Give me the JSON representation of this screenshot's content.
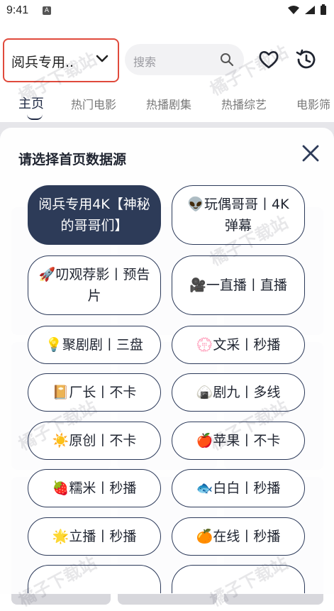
{
  "status_bar": {
    "time": "9:41",
    "notif": "A"
  },
  "header": {
    "source_label": "阅兵专用..",
    "search_placeholder": "搜索"
  },
  "tabs": [
    {
      "label": "主页"
    },
    {
      "label": "热门电影"
    },
    {
      "label": "热播剧集"
    },
    {
      "label": "热播综艺"
    },
    {
      "label": "电影筛"
    }
  ],
  "sheet": {
    "title": "请选择首页数据源",
    "options": [
      {
        "label": "阅兵专用4K【神秘的哥哥们】",
        "selected": true
      },
      {
        "label": "👽玩偶哥哥丨4K弹幕",
        "selected": false
      },
      {
        "label": "🚀叨观荐影丨预告片",
        "selected": false
      },
      {
        "label": "🎥一直播丨直播",
        "selected": false
      },
      {
        "label": "💡聚剧剧丨三盘",
        "selected": false
      },
      {
        "label": "💮文采丨秒播",
        "selected": false
      },
      {
        "label": "📔厂长丨不卡",
        "selected": false
      },
      {
        "label": "🍙剧九丨多线",
        "selected": false
      },
      {
        "label": "☀️原创丨不卡",
        "selected": false
      },
      {
        "label": "🍎苹果丨不卡",
        "selected": false
      },
      {
        "label": "🍓糯米丨秒播",
        "selected": false
      },
      {
        "label": "🐟白白丨秒播",
        "selected": false
      },
      {
        "label": "🌟立播丨秒播",
        "selected": false
      },
      {
        "label": "🍊在线丨秒播",
        "selected": false
      }
    ]
  },
  "watermark": "橘子下载站",
  "colors": {
    "accent": "#2d3b58",
    "highlight_border": "#e04a3c"
  }
}
